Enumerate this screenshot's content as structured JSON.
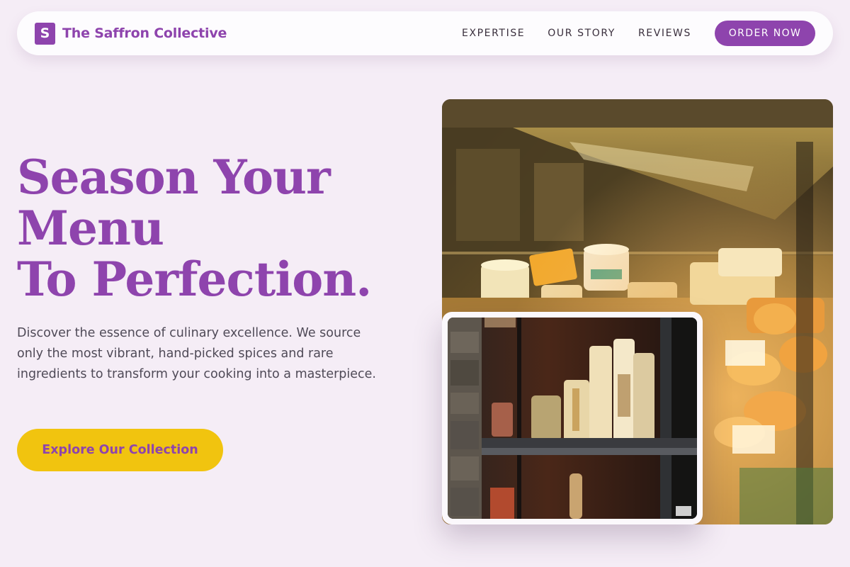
{
  "brand": {
    "logo_letter": "S",
    "name": "The Saffron Collective"
  },
  "nav": {
    "links": [
      "EXPERTISE",
      "OUR STORY",
      "REVIEWS"
    ],
    "cta": "ORDER NOW"
  },
  "hero": {
    "headline_lines": [
      "Season Your",
      "Menu",
      "To Perfection."
    ],
    "subtitle": "Discover the essence of culinary excellence. We source only the most vibrant, hand-picked spices and rare ingredients to transform your cooking into a masterpiece.",
    "cta": "Explore Our Collection"
  },
  "images": {
    "main": "deli-display-case-photo",
    "inset": "pasta-shelf-photo"
  },
  "colors": {
    "brand": "#8e44ad",
    "accent": "#f1c40f",
    "background": "#f5edf6"
  }
}
